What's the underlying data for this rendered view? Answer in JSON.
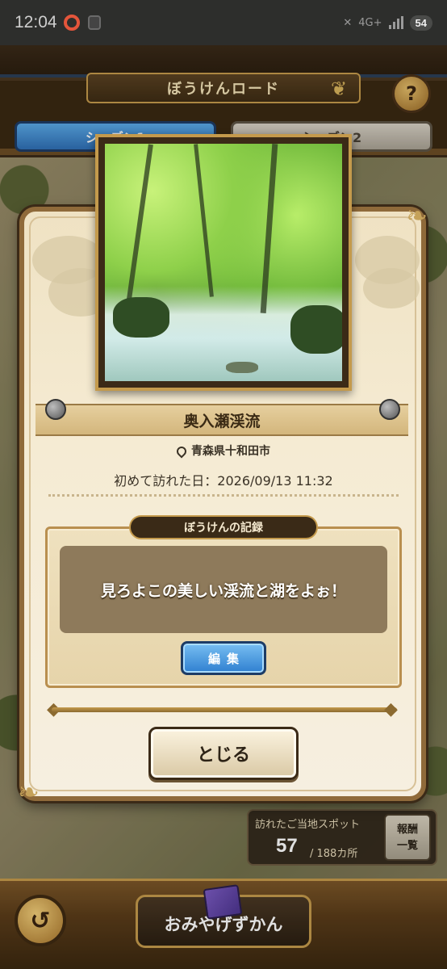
{
  "status_bar": {
    "time": "12:04",
    "network": "4G+",
    "battery": "54"
  },
  "header": {
    "title": "ぼうけんロード",
    "help_label": "?"
  },
  "tabs": [
    {
      "label": "シーズン1",
      "active": true
    },
    {
      "label": "シーズン2",
      "active": false
    }
  ],
  "modal": {
    "spot_name": "奥入瀬渓流",
    "location": "青森県十和田市",
    "first_visit": "初めて訪れた日：2026/09/13 11:32",
    "record_title": "ぼうけんの記録",
    "record_text": "見ろよこの美しい渓流と湖をよぉ！",
    "edit_label": "編集",
    "close_label": "とじる"
  },
  "spots": {
    "label": "訪れたご当地スポット",
    "count": "57",
    "total": "/ 188カ所"
  },
  "reward_button": {
    "line1": "報酬",
    "line2": "一覧"
  },
  "bottom": {
    "back_label": "↺",
    "souvenir_label": "おみやげずかん"
  },
  "colors": {
    "accent_gold": "#c49a4c",
    "tab_active": "#2f6fb5",
    "edit_blue": "#2f7fd0",
    "panel_bg": "#8e7a5b"
  }
}
